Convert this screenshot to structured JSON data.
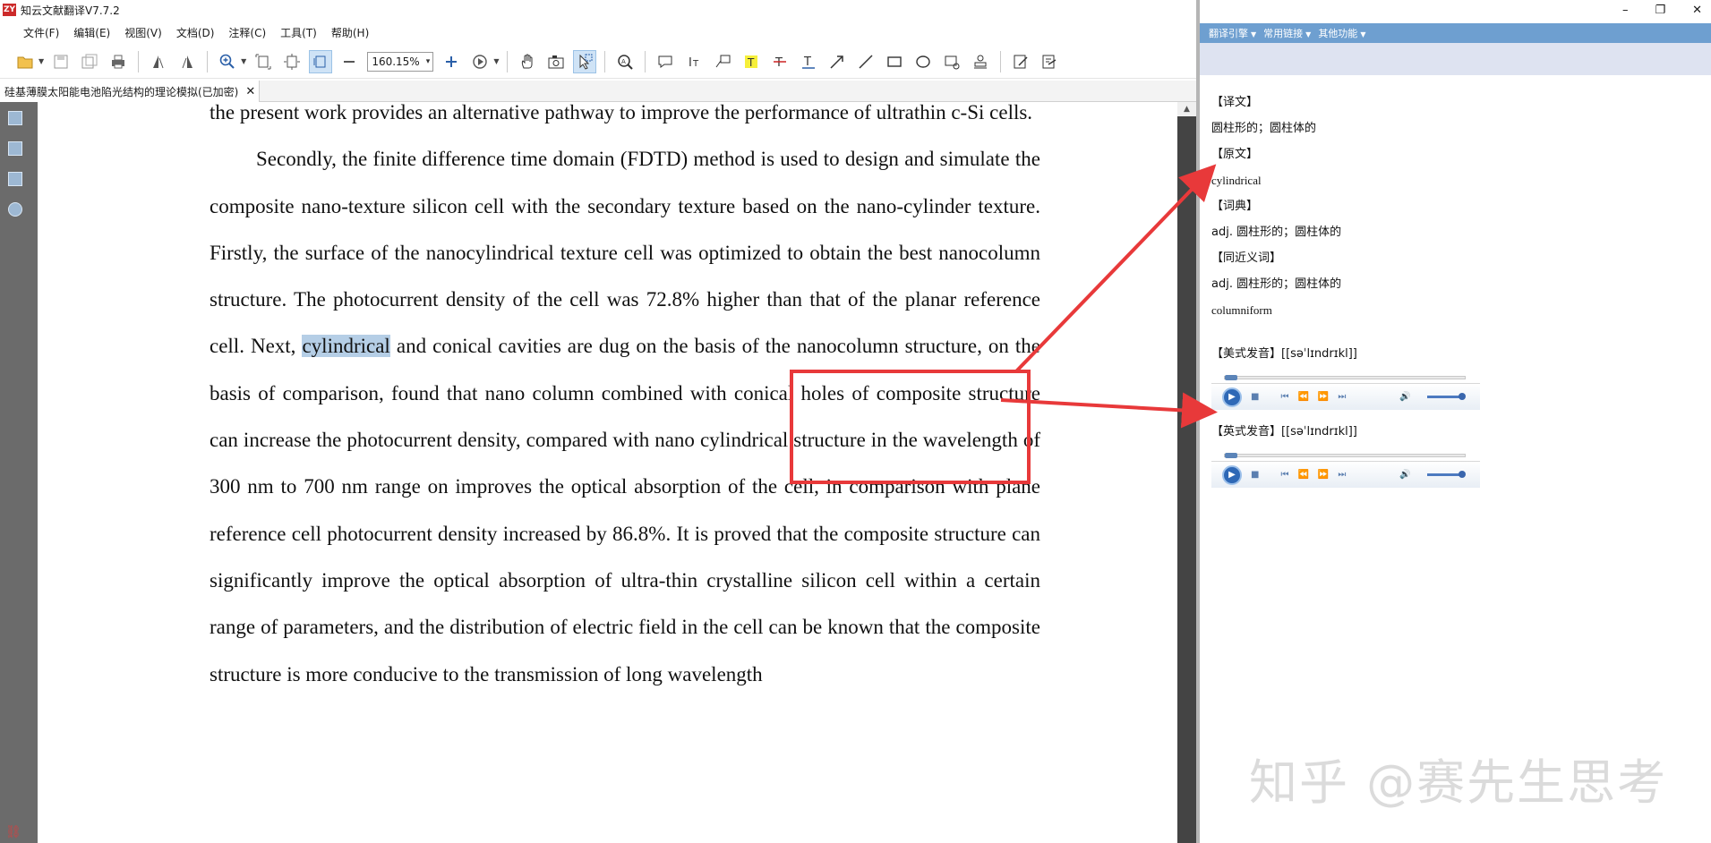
{
  "app": {
    "logo": "ZY",
    "title": "知云文献翻译V7.7.2"
  },
  "menu": [
    "文件(F)",
    "编辑(E)",
    "视图(V)",
    "文档(D)",
    "注释(C)",
    "工具(T)",
    "帮助(H)"
  ],
  "toolbar": {
    "zoom_value": "160.15%"
  },
  "tab": {
    "label": "硅基薄膜太阳能电池陷光结构的理论模拟(已加密)",
    "close": "✕"
  },
  "document": {
    "para1": "the present work provides an alternative pathway to improve the performance of ultrathin c-Si cells.",
    "para2_before": "Secondly, the finite difference time domain (FDTD) method is used to design and simulate the composite nano-texture silicon cell with the secondary texture based on the nano-cylinder texture. Firstly, the surface of the nanocylindrical texture cell was optimized to obtain the best nanocolumn structure. The photocurrent density of the cell was 72.8% higher than that of the planar reference cell. Next, ",
    "highlight": "cylindrical",
    "para2_after": " and conical cavities are dug on the basis of the nanocolumn structure, on the basis of comparison, found that nano column combined with conical holes of composite structure can increase the photocurrent density, compared with nano cylindrical structure in the wavelength of 300 nm to 700 nm range on improves the optical absorption of the cell, in comparison with plane reference cell photocurrent density increased by 86.8%. It is proved that the composite structure can significantly improve the optical absorption of ultra-thin crystalline silicon cell within a certain range of parameters, and the distribution of electric field in the cell can be known that the composite structure is more conducive to the transmission of long wavelength"
  },
  "panel": {
    "menu": [
      "翻译引擎",
      "常用链接",
      "其他功能"
    ],
    "translation_label": "【译文】",
    "translation": "圆柱形的；圆柱体的",
    "original_label": "【原文】",
    "original": "cylindrical",
    "dict_label": "【词典】",
    "dict": "adj. 圆柱形的；圆柱体的",
    "synonym_label": "【同近义词】",
    "synonym1": "adj. 圆柱形的；圆柱体的",
    "synonym2": "columniform",
    "us_label": "【美式发音】[[səˈlɪndrɪkl]]",
    "uk_label": "【英式发音】[[səˈlɪndrɪkl]]"
  },
  "window": {
    "minimize": "–",
    "restore": "❐",
    "close": "✕"
  },
  "watermark": "知乎 @赛先生思考",
  "colors": {
    "accent_bar": "#6e9fd0",
    "annotation": "#e8393a",
    "highlight": "#b5cee6",
    "rail": "#6b6b6b"
  }
}
